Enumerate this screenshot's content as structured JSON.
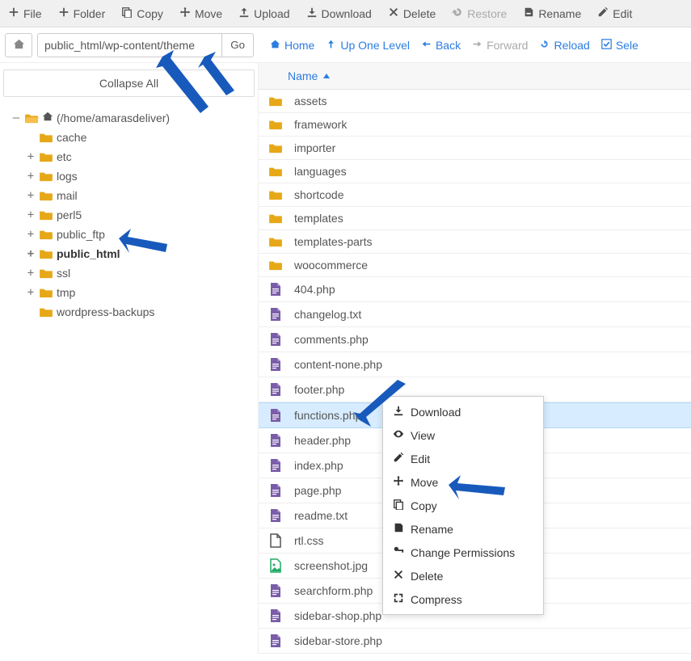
{
  "toolbar": {
    "file": "File",
    "folder": "Folder",
    "copy": "Copy",
    "move": "Move",
    "upload": "Upload",
    "download": "Download",
    "delete": "Delete",
    "restore": "Restore",
    "rename": "Rename",
    "edit": "Edit"
  },
  "path": {
    "value": "public_html/wp-content/theme",
    "go": "Go"
  },
  "nav": {
    "home": "Home",
    "up": "Up One Level",
    "back": "Back",
    "forward": "Forward",
    "reload": "Reload",
    "select_all": "Sele"
  },
  "sidebar": {
    "collapse_all": "Collapse All",
    "root_label": "(/home/amarasdeliver)",
    "items": [
      {
        "label": "cache",
        "expandable": false
      },
      {
        "label": "etc",
        "expandable": true
      },
      {
        "label": "logs",
        "expandable": true
      },
      {
        "label": "mail",
        "expandable": true
      },
      {
        "label": "perl5",
        "expandable": true
      },
      {
        "label": "public_ftp",
        "expandable": true
      },
      {
        "label": "public_html",
        "expandable": true,
        "bold": true
      },
      {
        "label": "ssl",
        "expandable": true
      },
      {
        "label": "tmp",
        "expandable": true
      },
      {
        "label": "wordpress-backups",
        "expandable": false
      }
    ]
  },
  "filelist": {
    "header": "Name",
    "rows": [
      {
        "name": "assets",
        "type": "folder"
      },
      {
        "name": "framework",
        "type": "folder"
      },
      {
        "name": "importer",
        "type": "folder"
      },
      {
        "name": "languages",
        "type": "folder"
      },
      {
        "name": "shortcode",
        "type": "folder"
      },
      {
        "name": "templates",
        "type": "folder"
      },
      {
        "name": "templates-parts",
        "type": "folder"
      },
      {
        "name": "woocommerce",
        "type": "folder"
      },
      {
        "name": "404.php",
        "type": "php"
      },
      {
        "name": "changelog.txt",
        "type": "txt"
      },
      {
        "name": "comments.php",
        "type": "php"
      },
      {
        "name": "content-none.php",
        "type": "php"
      },
      {
        "name": "footer.php",
        "type": "php"
      },
      {
        "name": "functions.php",
        "type": "php",
        "selected": true
      },
      {
        "name": "header.php",
        "type": "php"
      },
      {
        "name": "index.php",
        "type": "php"
      },
      {
        "name": "page.php",
        "type": "php"
      },
      {
        "name": "readme.txt",
        "type": "txt"
      },
      {
        "name": "rtl.css",
        "type": "css"
      },
      {
        "name": "screenshot.jpg",
        "type": "jpg"
      },
      {
        "name": "searchform.php",
        "type": "php"
      },
      {
        "name": "sidebar-shop.php",
        "type": "php"
      },
      {
        "name": "sidebar-store.php",
        "type": "php"
      }
    ]
  },
  "context_menu": {
    "download": "Download",
    "view": "View",
    "edit": "Edit",
    "move": "Move",
    "copy": "Copy",
    "rename": "Rename",
    "permissions": "Change Permissions",
    "delete": "Delete",
    "compress": "Compress"
  }
}
